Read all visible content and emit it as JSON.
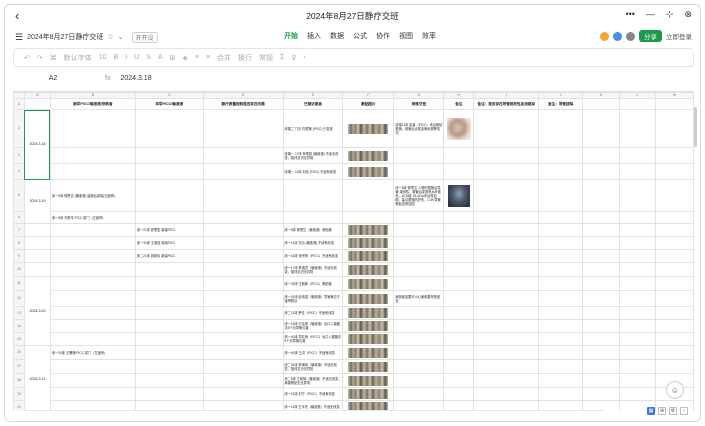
{
  "window": {
    "title": "2024年8月27日静疗交班"
  },
  "menubar": {
    "doc_name": "2024年8月27日静疗交班",
    "badge": "开开设",
    "tabs": [
      {
        "label": "开始",
        "active": true
      },
      {
        "label": "插入"
      },
      {
        "label": "数据"
      },
      {
        "label": "公式"
      },
      {
        "label": "协作"
      },
      {
        "label": "视图"
      },
      {
        "label": "效率"
      }
    ],
    "share_label": "分享",
    "login_label": "立即登录"
  },
  "toolbar": {
    "font_name": "默认字体",
    "font_size": "10",
    "merge_label": "合并",
    "wrap_label": "换行",
    "format_label": "常规"
  },
  "formula_bar": {
    "cell_ref": "A2",
    "fx": "fx",
    "value": "2024.3.18"
  },
  "columns": [
    "A",
    "B",
    "C",
    "D",
    "E",
    "F",
    "G",
    "H",
    "I",
    "J",
    "K",
    "L",
    "M"
  ],
  "header_row": {
    "b": "新学PICC/输液港/穿刺者",
    "c": "非学PICC/输液港",
    "d": "静疗质量控制是否存在问题",
    "e": "已随访患者",
    "f": "敷贴图片",
    "g": "特殊交班",
    "h": "备注",
    "i": "备注：是否存在导管相关性血流感染",
    "j": "备注：导管拔除"
  },
  "rows": [
    {
      "num": "2",
      "date": "2024.3.18",
      "e": "床端二 门诊 内镜管 (PICC) 已复查",
      "g": "床端11床 患者（PICC）术后敷贴更换，置管后出现血管渗漏等情况",
      "photo": true
    },
    {
      "num": "3",
      "e": "床端一 17床 林寿权 (输液港) 不适无改变，陪伴意识无异常"
    },
    {
      "num": "4",
      "e": "床端一 11床 刘欢 (PICC) 不适有改变"
    },
    {
      "num": "5",
      "date": "2024.3.19",
      "b": "床一5床 徐思达 (输液港) 建静后拔除(左锁骨)",
      "g": "床一5床 徐思达 入院时插管后导管 观测性，置管后发现有水状液渗，4CM经 18-4Cm未出现血肿，建议更换防护衣，CVA 导管敷贴没有加固",
      "xray": true
    },
    {
      "num": "6",
      "b": "床一5床 刘贵华 PICC 拔门（左锁骨）"
    },
    {
      "num": "7",
      "c": "床一21床 张思宏 新建PICC",
      "e": "床一5床 徐思达（输液港）敷贴管"
    },
    {
      "num": "8",
      "c": "床一30床 王淑霞 收纳PICC",
      "e": "床一11床 刘沁 (输液港) 不适有改变"
    },
    {
      "num": "9",
      "c": "床二21床 张新民 新建PICC",
      "e": "床一13床 张宗贤（PICC）不适有改变"
    },
    {
      "num": "10",
      "e": "床一17床 林强洋（输液港）不适无改变，陪伴意识无异常"
    },
    {
      "num": "11",
      "date": "2024.3.20",
      "e": "床一25床 王新新（PICC）敷贴管"
    },
    {
      "num": "12",
      "e": "床一31床 赵伟强（输液港）导管管位于锁骨附近",
      "g": "局部回血要不小心使用要尽快回复"
    },
    {
      "num": "13",
      "e": "床二11床 罗佳（PICC）不适有改变"
    },
    {
      "num": "14",
      "e": "床一15床 方嘉琪（输液港）出口入路随访5个月导管位置"
    },
    {
      "num": "15",
      "e": "床一40床 章红雨（PICC）出口入路随访5个月导管位置"
    },
    {
      "num": "16",
      "date": "2024.3.21",
      "b": "床一20床 王珊珊 PICC 拔门（左锁骨）",
      "e": "床一40床 王洪（PICC）不适有改变"
    },
    {
      "num": "17",
      "e": "床二24床 林海军（输液港）不适无改变，陪伴意识无异常"
    },
    {
      "num": "18",
      "e": "床二5床 江和辉（输液港）不适无改变，局部敷贴无无异常"
    },
    {
      "num": "19",
      "e": "床一15床 刘宁（PICC）不适有改变"
    },
    {
      "num": "20",
      "e": "床一11床 王平东（输液港）不适无改变"
    }
  ],
  "icon_names": [
    "back-arrow-icon",
    "menu-icon",
    "star-icon",
    "undo-icon",
    "redo-icon",
    "fx-icon",
    "help-icon"
  ]
}
